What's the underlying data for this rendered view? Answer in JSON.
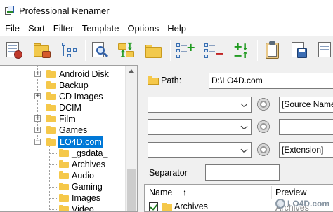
{
  "window": {
    "title": "Professional Renamer"
  },
  "menu": [
    "File",
    "Sort",
    "Filter",
    "Template",
    "Options",
    "Help"
  ],
  "toolbar": {
    "buttons": [
      "rename-tool-icon",
      "open-folder-icon",
      "tree-view-icon",
      "search-files-icon",
      "move-files-icon",
      "folder-icon",
      "add-items-icon",
      "remove-items-icon",
      "add-remove-icon",
      "clipboard-icon",
      "save-icon",
      "document-icon"
    ]
  },
  "tree": {
    "items": [
      {
        "label": "Android Disk",
        "expander": "+"
      },
      {
        "label": "Backup",
        "expander": ""
      },
      {
        "label": "CD Images",
        "expander": "+"
      },
      {
        "label": "DCIM",
        "expander": ""
      },
      {
        "label": "Film",
        "expander": "+"
      },
      {
        "label": "Games",
        "expander": "+"
      },
      {
        "label": "LO4D.com",
        "expander": "−",
        "selected": true
      },
      {
        "label": "_gsdata_",
        "expander": ""
      },
      {
        "label": "Archives",
        "expander": ""
      },
      {
        "label": "Audio",
        "expander": ""
      },
      {
        "label": "Gaming",
        "expander": ""
      },
      {
        "label": "Images",
        "expander": ""
      },
      {
        "label": "Video",
        "expander": ""
      }
    ]
  },
  "path": {
    "label": "Path:",
    "value": "D:\\LO4D.com"
  },
  "rules": [
    {
      "combo": "",
      "field": "[Source Name]"
    },
    {
      "combo": "",
      "field": ""
    },
    {
      "combo": "",
      "field": "[Extension]"
    }
  ],
  "separator": {
    "label": "Separator",
    "value": ""
  },
  "filelist": {
    "col_name": "Name",
    "sort_arrow": "🠕",
    "col_preview": "Preview",
    "rows": [
      {
        "name": "Archives",
        "checked": true,
        "preview": "Archives"
      }
    ]
  },
  "watermark": {
    "text": "LO4D.com"
  },
  "colors": {
    "selection": "#0078d7",
    "folder": "#f5c84a"
  }
}
